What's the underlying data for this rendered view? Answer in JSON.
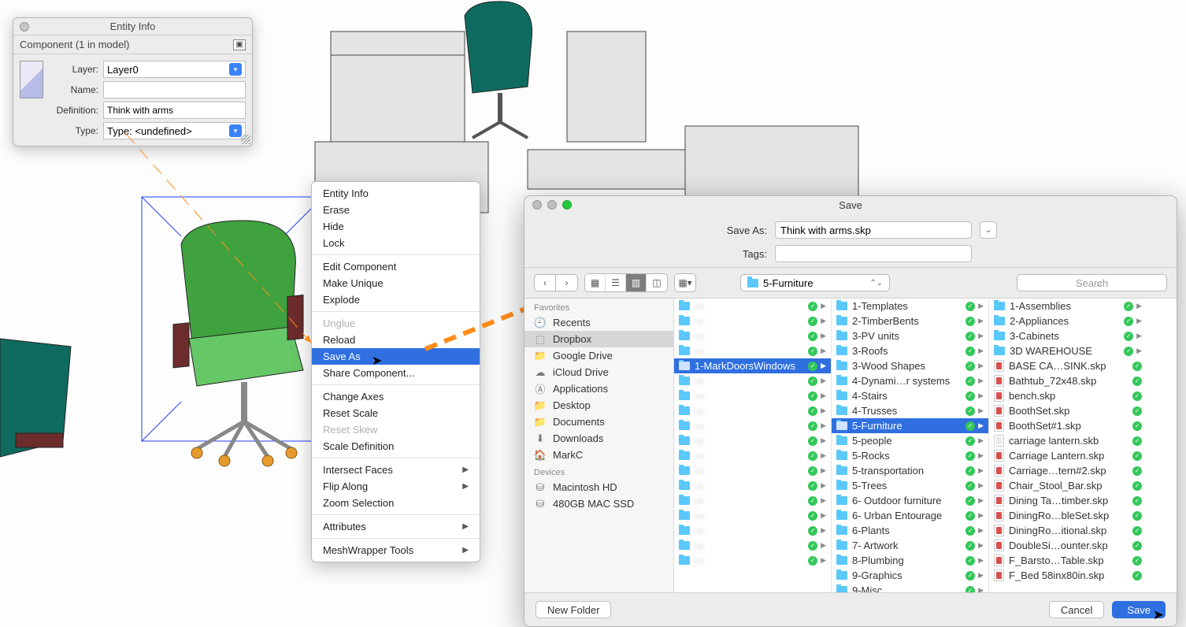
{
  "entity_info": {
    "title": "Entity Info",
    "subtitle": "Component (1 in model)",
    "fields": {
      "layer_label": "Layer:",
      "layer_value": "Layer0",
      "name_label": "Name:",
      "name_value": "",
      "definition_label": "Definition:",
      "definition_value": "Think with arms",
      "type_label": "Type:",
      "type_value": "Type: <undefined>"
    }
  },
  "context_menu": {
    "groups": [
      [
        "Entity Info",
        "Erase",
        "Hide",
        "Lock"
      ],
      [
        "Edit Component",
        "Make Unique",
        "Explode"
      ],
      [
        "Unglue",
        "Reload",
        "Save As",
        "Share Component..."
      ],
      [
        "Change Axes",
        "Reset Scale",
        "Reset Skew",
        "Scale Definition"
      ],
      [
        "Intersect Faces",
        "Flip Along",
        "Zoom Selection"
      ],
      [
        "Attributes"
      ],
      [
        "MeshWrapper Tools"
      ]
    ],
    "disabled": [
      "Unglue",
      "Reset Skew"
    ],
    "selected": "Save As",
    "submenu": [
      "Intersect Faces",
      "Flip Along",
      "Attributes",
      "MeshWrapper Tools"
    ]
  },
  "save_dialog": {
    "title": "Save",
    "saveas_label": "Save As:",
    "saveas_value": "Think with arms.skp",
    "tags_label": "Tags:",
    "tags_value": "",
    "location": "5-Furniture",
    "search_placeholder": "Search",
    "sidebar": {
      "favorites_label": "Favorites",
      "favorites": [
        {
          "icon": "clock",
          "label": "Recents"
        },
        {
          "icon": "dropbox",
          "label": "Dropbox",
          "selected": true
        },
        {
          "icon": "folder",
          "label": "Google Drive"
        },
        {
          "icon": "cloud",
          "label": "iCloud Drive"
        },
        {
          "icon": "app",
          "label": "Applications"
        },
        {
          "icon": "folder",
          "label": "Desktop"
        },
        {
          "icon": "folder",
          "label": "Documents"
        },
        {
          "icon": "download",
          "label": "Downloads"
        },
        {
          "icon": "home",
          "label": "MarkC"
        }
      ],
      "devices_label": "Devices",
      "devices": [
        {
          "icon": "disk",
          "label": "Macintosh HD"
        },
        {
          "icon": "disk",
          "label": "480GB MAC SSD"
        }
      ]
    },
    "columns": [
      {
        "blurred": true,
        "items": [
          {
            "t": "folder",
            "label": "—",
            "sync": true
          },
          {
            "t": "folder",
            "label": "—",
            "sync": true
          },
          {
            "t": "folder",
            "label": "—",
            "sync": true
          },
          {
            "t": "folder",
            "label": "—",
            "sync": true
          },
          {
            "t": "folder",
            "label": "1-MarkDoorsWindows",
            "sync": true,
            "selected": true,
            "clear": true
          },
          {
            "t": "folder",
            "label": "—",
            "sync": true
          },
          {
            "t": "folder",
            "label": "—",
            "sync": true
          },
          {
            "t": "folder",
            "label": "—",
            "sync": true
          },
          {
            "t": "folder",
            "label": "—",
            "sync": true
          },
          {
            "t": "folder",
            "label": "—",
            "sync": true
          },
          {
            "t": "folder",
            "label": "—",
            "sync": true
          },
          {
            "t": "folder",
            "label": "—",
            "sync": true
          },
          {
            "t": "folder",
            "label": "—",
            "sync": true
          },
          {
            "t": "folder",
            "label": "—",
            "sync": true
          },
          {
            "t": "folder",
            "label": "—",
            "sync": true
          },
          {
            "t": "folder",
            "label": "—",
            "sync": true
          },
          {
            "t": "folder",
            "label": "—",
            "sync": true
          },
          {
            "t": "folder",
            "label": "—",
            "sync": true
          }
        ]
      },
      {
        "items": [
          {
            "t": "folder",
            "label": "1-Templates",
            "sync": true
          },
          {
            "t": "folder",
            "label": "2-TimberBents",
            "sync": true
          },
          {
            "t": "folder",
            "label": "3-PV units",
            "sync": true
          },
          {
            "t": "folder",
            "label": "3-Roofs",
            "sync": true
          },
          {
            "t": "folder",
            "label": "3-Wood Shapes",
            "sync": true
          },
          {
            "t": "folder",
            "label": "4-Dynami…r systems",
            "sync": true
          },
          {
            "t": "folder",
            "label": "4-Stairs",
            "sync": true
          },
          {
            "t": "folder",
            "label": "4-Trusses",
            "sync": true
          },
          {
            "t": "folder",
            "label": "5-Furniture",
            "sync": true,
            "selected": true
          },
          {
            "t": "folder",
            "label": "5-people",
            "sync": true
          },
          {
            "t": "folder",
            "label": "5-Rocks",
            "sync": true
          },
          {
            "t": "folder",
            "label": "5-transportation",
            "sync": true
          },
          {
            "t": "folder",
            "label": "5-Trees",
            "sync": true
          },
          {
            "t": "folder",
            "label": "6- Outdoor furniture",
            "sync": true
          },
          {
            "t": "folder",
            "label": "6- Urban Entourage",
            "sync": true
          },
          {
            "t": "folder",
            "label": "6-Plants",
            "sync": true
          },
          {
            "t": "folder",
            "label": "7- Artwork",
            "sync": true
          },
          {
            "t": "folder",
            "label": "8-Plumbing",
            "sync": true
          },
          {
            "t": "folder",
            "label": "9-Graphics",
            "sync": true
          },
          {
            "t": "folder",
            "label": "9-Misc",
            "sync": true
          }
        ]
      },
      {
        "items": [
          {
            "t": "folder",
            "label": "1-Assemblies",
            "sync": true
          },
          {
            "t": "folder",
            "label": "2-Appliances",
            "sync": true
          },
          {
            "t": "folder",
            "label": "3-Cabinets",
            "sync": true
          },
          {
            "t": "folder",
            "label": "3D WAREHOUSE",
            "sync": true
          },
          {
            "t": "skp",
            "label": "BASE CA…SINK.skp",
            "sync": true
          },
          {
            "t": "skp",
            "label": "Bathtub_72x48.skp",
            "sync": true
          },
          {
            "t": "skp",
            "label": "bench.skp",
            "sync": true
          },
          {
            "t": "skp",
            "label": "BoothSet.skp",
            "sync": true
          },
          {
            "t": "skp",
            "label": "BoothSet#1.skp",
            "sync": true
          },
          {
            "t": "skb",
            "label": "carriage lantern.skb",
            "sync": true
          },
          {
            "t": "skp",
            "label": "Carriage Lantern.skp",
            "sync": true
          },
          {
            "t": "skp",
            "label": "Carriage…tern#2.skp",
            "sync": true
          },
          {
            "t": "skp",
            "label": "Chair_Stool_Bar.skp",
            "sync": true
          },
          {
            "t": "skp",
            "label": "Dining Ta…timber.skp",
            "sync": true
          },
          {
            "t": "skp",
            "label": "DiningRo…bleSet.skp",
            "sync": true
          },
          {
            "t": "skp",
            "label": "DiningRo…itional.skp",
            "sync": true
          },
          {
            "t": "skp",
            "label": "DoubleSi…ounter.skp",
            "sync": true
          },
          {
            "t": "skp",
            "label": "F_Barsto…Table.skp",
            "sync": true
          },
          {
            "t": "skp",
            "label": "F_Bed 58inx80in.skp",
            "sync": true
          }
        ]
      }
    ],
    "footer": {
      "new_folder": "New Folder",
      "cancel": "Cancel",
      "save": "Save"
    }
  }
}
